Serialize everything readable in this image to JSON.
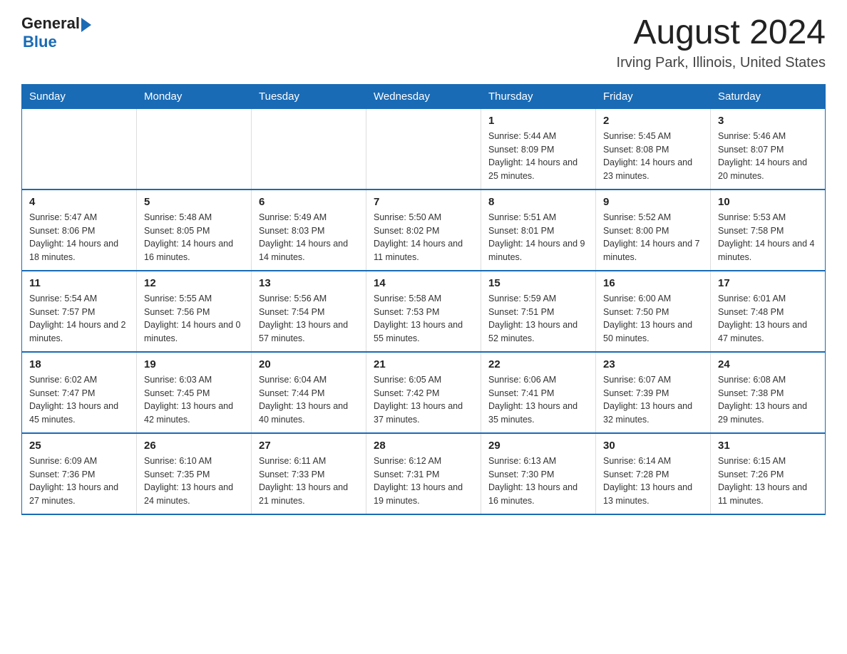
{
  "header": {
    "logo": {
      "general": "General",
      "blue": "Blue",
      "arrow": "▶"
    },
    "title": "August 2024",
    "location": "Irving Park, Illinois, United States"
  },
  "days_of_week": [
    "Sunday",
    "Monday",
    "Tuesday",
    "Wednesday",
    "Thursday",
    "Friday",
    "Saturday"
  ],
  "weeks": [
    [
      {
        "day": "",
        "info": ""
      },
      {
        "day": "",
        "info": ""
      },
      {
        "day": "",
        "info": ""
      },
      {
        "day": "",
        "info": ""
      },
      {
        "day": "1",
        "info": "Sunrise: 5:44 AM\nSunset: 8:09 PM\nDaylight: 14 hours\nand 25 minutes."
      },
      {
        "day": "2",
        "info": "Sunrise: 5:45 AM\nSunset: 8:08 PM\nDaylight: 14 hours\nand 23 minutes."
      },
      {
        "day": "3",
        "info": "Sunrise: 5:46 AM\nSunset: 8:07 PM\nDaylight: 14 hours\nand 20 minutes."
      }
    ],
    [
      {
        "day": "4",
        "info": "Sunrise: 5:47 AM\nSunset: 8:06 PM\nDaylight: 14 hours\nand 18 minutes."
      },
      {
        "day": "5",
        "info": "Sunrise: 5:48 AM\nSunset: 8:05 PM\nDaylight: 14 hours\nand 16 minutes."
      },
      {
        "day": "6",
        "info": "Sunrise: 5:49 AM\nSunset: 8:03 PM\nDaylight: 14 hours\nand 14 minutes."
      },
      {
        "day": "7",
        "info": "Sunrise: 5:50 AM\nSunset: 8:02 PM\nDaylight: 14 hours\nand 11 minutes."
      },
      {
        "day": "8",
        "info": "Sunrise: 5:51 AM\nSunset: 8:01 PM\nDaylight: 14 hours\nand 9 minutes."
      },
      {
        "day": "9",
        "info": "Sunrise: 5:52 AM\nSunset: 8:00 PM\nDaylight: 14 hours\nand 7 minutes."
      },
      {
        "day": "10",
        "info": "Sunrise: 5:53 AM\nSunset: 7:58 PM\nDaylight: 14 hours\nand 4 minutes."
      }
    ],
    [
      {
        "day": "11",
        "info": "Sunrise: 5:54 AM\nSunset: 7:57 PM\nDaylight: 14 hours\nand 2 minutes."
      },
      {
        "day": "12",
        "info": "Sunrise: 5:55 AM\nSunset: 7:56 PM\nDaylight: 14 hours\nand 0 minutes."
      },
      {
        "day": "13",
        "info": "Sunrise: 5:56 AM\nSunset: 7:54 PM\nDaylight: 13 hours\nand 57 minutes."
      },
      {
        "day": "14",
        "info": "Sunrise: 5:58 AM\nSunset: 7:53 PM\nDaylight: 13 hours\nand 55 minutes."
      },
      {
        "day": "15",
        "info": "Sunrise: 5:59 AM\nSunset: 7:51 PM\nDaylight: 13 hours\nand 52 minutes."
      },
      {
        "day": "16",
        "info": "Sunrise: 6:00 AM\nSunset: 7:50 PM\nDaylight: 13 hours\nand 50 minutes."
      },
      {
        "day": "17",
        "info": "Sunrise: 6:01 AM\nSunset: 7:48 PM\nDaylight: 13 hours\nand 47 minutes."
      }
    ],
    [
      {
        "day": "18",
        "info": "Sunrise: 6:02 AM\nSunset: 7:47 PM\nDaylight: 13 hours\nand 45 minutes."
      },
      {
        "day": "19",
        "info": "Sunrise: 6:03 AM\nSunset: 7:45 PM\nDaylight: 13 hours\nand 42 minutes."
      },
      {
        "day": "20",
        "info": "Sunrise: 6:04 AM\nSunset: 7:44 PM\nDaylight: 13 hours\nand 40 minutes."
      },
      {
        "day": "21",
        "info": "Sunrise: 6:05 AM\nSunset: 7:42 PM\nDaylight: 13 hours\nand 37 minutes."
      },
      {
        "day": "22",
        "info": "Sunrise: 6:06 AM\nSunset: 7:41 PM\nDaylight: 13 hours\nand 35 minutes."
      },
      {
        "day": "23",
        "info": "Sunrise: 6:07 AM\nSunset: 7:39 PM\nDaylight: 13 hours\nand 32 minutes."
      },
      {
        "day": "24",
        "info": "Sunrise: 6:08 AM\nSunset: 7:38 PM\nDaylight: 13 hours\nand 29 minutes."
      }
    ],
    [
      {
        "day": "25",
        "info": "Sunrise: 6:09 AM\nSunset: 7:36 PM\nDaylight: 13 hours\nand 27 minutes."
      },
      {
        "day": "26",
        "info": "Sunrise: 6:10 AM\nSunset: 7:35 PM\nDaylight: 13 hours\nand 24 minutes."
      },
      {
        "day": "27",
        "info": "Sunrise: 6:11 AM\nSunset: 7:33 PM\nDaylight: 13 hours\nand 21 minutes."
      },
      {
        "day": "28",
        "info": "Sunrise: 6:12 AM\nSunset: 7:31 PM\nDaylight: 13 hours\nand 19 minutes."
      },
      {
        "day": "29",
        "info": "Sunrise: 6:13 AM\nSunset: 7:30 PM\nDaylight: 13 hours\nand 16 minutes."
      },
      {
        "day": "30",
        "info": "Sunrise: 6:14 AM\nSunset: 7:28 PM\nDaylight: 13 hours\nand 13 minutes."
      },
      {
        "day": "31",
        "info": "Sunrise: 6:15 AM\nSunset: 7:26 PM\nDaylight: 13 hours\nand 11 minutes."
      }
    ]
  ]
}
